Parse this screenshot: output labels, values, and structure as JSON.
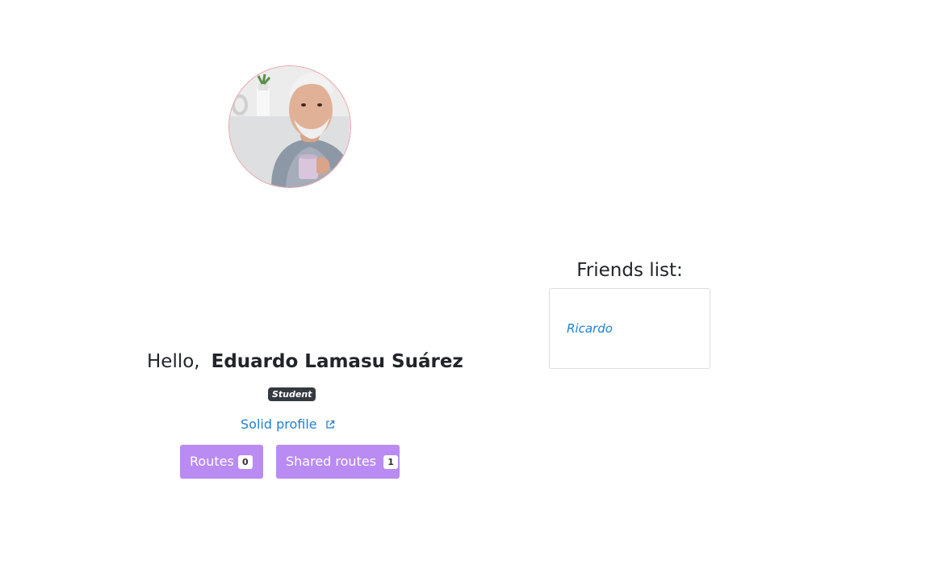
{
  "profile": {
    "avatar_alt": "Profile picture",
    "greeting": "Hello,",
    "name": "Eduardo Lamasu Suárez",
    "role": "Student",
    "solid_link_label": "Solid profile"
  },
  "actions": {
    "routes_label": "Routes",
    "routes_count": "0",
    "shared_label": "Shared routes",
    "shared_count": "1"
  },
  "friends": {
    "title": "Friends list:",
    "items": [
      "Ricardo"
    ]
  },
  "colors": {
    "button_bg": "#b98bf3",
    "link": "#1f7fcf",
    "badge_bg": "#343a40"
  }
}
